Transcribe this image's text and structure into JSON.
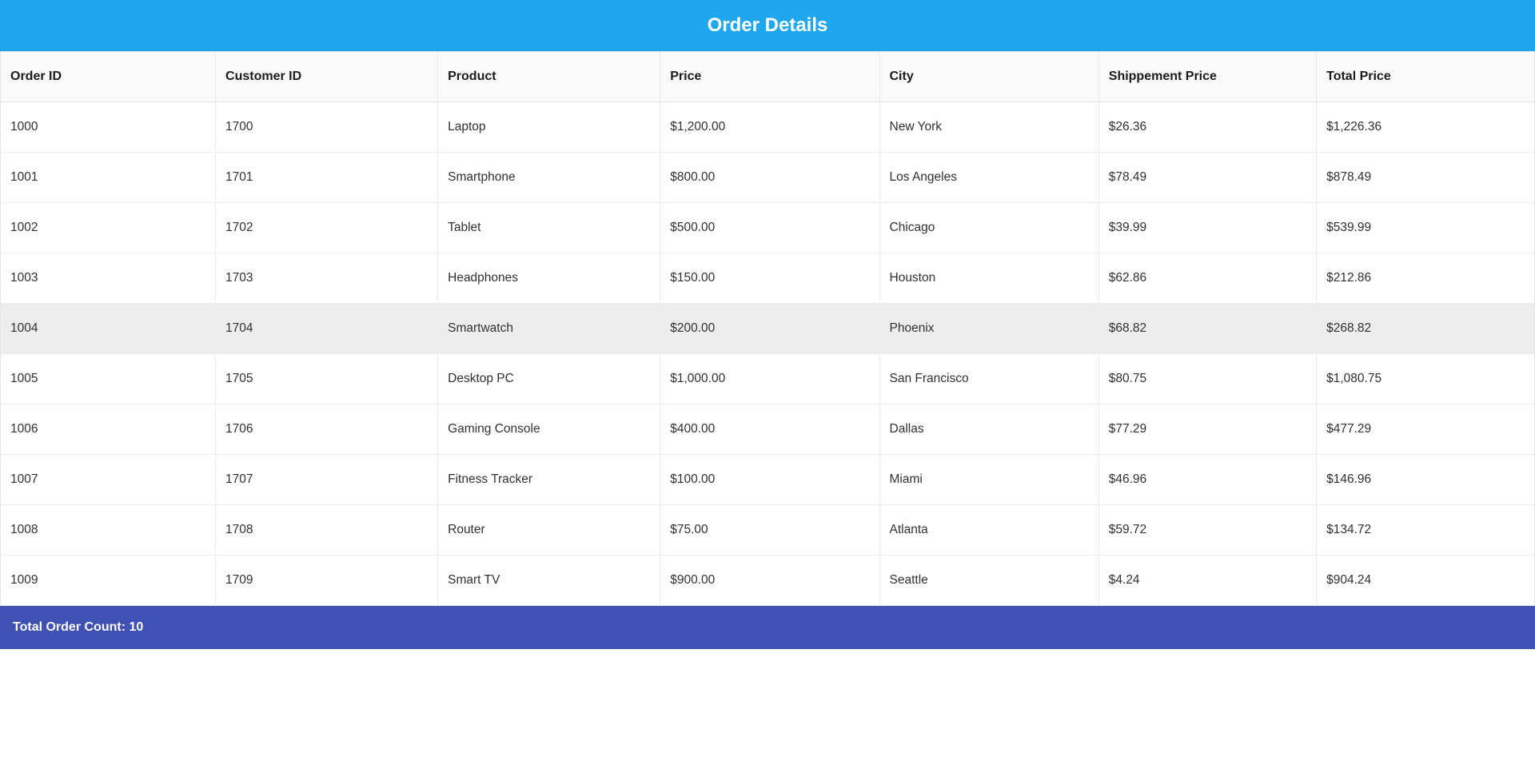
{
  "header": {
    "title": "Order Details"
  },
  "table": {
    "columns": [
      {
        "label": "Order ID"
      },
      {
        "label": "Customer ID"
      },
      {
        "label": "Product"
      },
      {
        "label": "Price"
      },
      {
        "label": "City"
      },
      {
        "label": "Shippement Price"
      },
      {
        "label": "Total Price"
      }
    ],
    "rows": [
      {
        "orderId": "1000",
        "customerId": "1700",
        "product": "Laptop",
        "price": "$1,200.00",
        "city": "New York",
        "shipPrice": "$26.36",
        "totalPrice": "$1,226.36"
      },
      {
        "orderId": "1001",
        "customerId": "1701",
        "product": "Smartphone",
        "price": "$800.00",
        "city": "Los Angeles",
        "shipPrice": "$78.49",
        "totalPrice": "$878.49"
      },
      {
        "orderId": "1002",
        "customerId": "1702",
        "product": "Tablet",
        "price": "$500.00",
        "city": "Chicago",
        "shipPrice": "$39.99",
        "totalPrice": "$539.99"
      },
      {
        "orderId": "1003",
        "customerId": "1703",
        "product": "Headphones",
        "price": "$150.00",
        "city": "Houston",
        "shipPrice": "$62.86",
        "totalPrice": "$212.86"
      },
      {
        "orderId": "1004",
        "customerId": "1704",
        "product": "Smartwatch",
        "price": "$200.00",
        "city": "Phoenix",
        "shipPrice": "$68.82",
        "totalPrice": "$268.82",
        "hovered": true
      },
      {
        "orderId": "1005",
        "customerId": "1705",
        "product": "Desktop PC",
        "price": "$1,000.00",
        "city": "San Francisco",
        "shipPrice": "$80.75",
        "totalPrice": "$1,080.75"
      },
      {
        "orderId": "1006",
        "customerId": "1706",
        "product": "Gaming Console",
        "price": "$400.00",
        "city": "Dallas",
        "shipPrice": "$77.29",
        "totalPrice": "$477.29"
      },
      {
        "orderId": "1007",
        "customerId": "1707",
        "product": "Fitness Tracker",
        "price": "$100.00",
        "city": "Miami",
        "shipPrice": "$46.96",
        "totalPrice": "$146.96"
      },
      {
        "orderId": "1008",
        "customerId": "1708",
        "product": "Router",
        "price": "$75.00",
        "city": "Atlanta",
        "shipPrice": "$59.72",
        "totalPrice": "$134.72"
      },
      {
        "orderId": "1009",
        "customerId": "1709",
        "product": "Smart TV",
        "price": "$900.00",
        "city": "Seattle",
        "shipPrice": "$4.24",
        "totalPrice": "$904.24"
      }
    ]
  },
  "footer": {
    "label": "Total Order Count: 10"
  }
}
